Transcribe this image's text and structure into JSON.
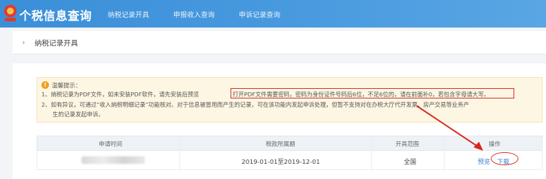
{
  "app": {
    "title": "个税信息查询"
  },
  "nav": {
    "items": [
      {
        "label": "纳税记录开具"
      },
      {
        "label": "申报收入查询"
      },
      {
        "label": "申诉记录查询"
      }
    ]
  },
  "breadcrumb": {
    "arrow": "›",
    "label": "纳税记录开具"
  },
  "tip": {
    "icon": "!",
    "title": "温馨提示：",
    "line1_prefix": "1、纳税记录为PDF文件，如未安装PDF软件，请先安装后预览",
    "line1_highlight": "打开PDF文件需要密码，密码为身份证件号码后6位，不足6位的，请在前面补0，若包含字母请大写。",
    "line2": "2、如有异议，可通过“收入纳税明细记录”功能核对。对于信息被冒用而产生的记录，可在该功能内发起申诉处理，但暂不支持对在办税大厅代开发票、房产交易等业务产",
    "line3": "生的记录发起申诉。"
  },
  "table": {
    "headers": [
      "申请时间",
      "税款所属期",
      "开具范围",
      "操作"
    ],
    "rows": [
      {
        "apply_time": "",
        "period": "2019-01-01至2019-12-01",
        "scope": "全国",
        "actions": {
          "preview": "预览",
          "download": "下载"
        }
      }
    ]
  },
  "colors": {
    "nav_bg": "#4a9be0",
    "annotation_red": "#d9261c",
    "link_blue": "#3a7fd0",
    "tip_bg": "#fdf6e3"
  }
}
